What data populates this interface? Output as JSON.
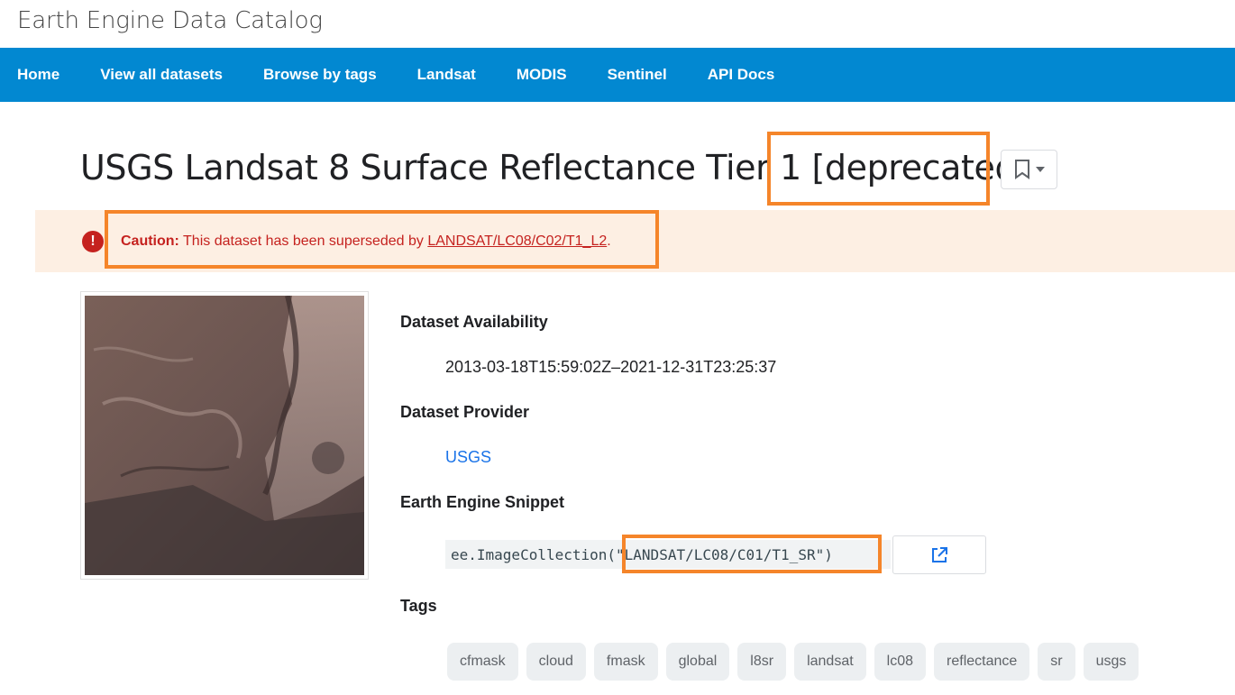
{
  "site": {
    "title": "Earth Engine Data Catalog"
  },
  "nav": {
    "items": [
      {
        "label": "Home"
      },
      {
        "label": "View all datasets"
      },
      {
        "label": "Browse by tags"
      },
      {
        "label": "Landsat"
      },
      {
        "label": "MODIS"
      },
      {
        "label": "Sentinel"
      },
      {
        "label": "API Docs"
      }
    ]
  },
  "dataset": {
    "title_main": "USGS Landsat 8 Surface Reflectance Tier 1 ",
    "title_status": "[deprecated]",
    "caution": {
      "label": "Caution:",
      "text": " This dataset has been superseded by ",
      "link": "LANDSAT/LC08/C02/T1_L2",
      "suffix": "."
    },
    "availability_label": "Dataset Availability",
    "availability_value": "2013-03-18T15:59:02Z–2021-12-31T23:25:37",
    "provider_label": "Dataset Provider",
    "provider_value": "USGS",
    "snippet_label": "Earth Engine Snippet",
    "snippet_prefix": "ee.ImageCollection",
    "snippet_arg": "(\"LANDSAT/LC08/C01/T1_SR\")",
    "tags_label": "Tags",
    "tags": [
      "cfmask",
      "cloud",
      "fmask",
      "global",
      "l8sr",
      "landsat",
      "lc08",
      "reflectance",
      "sr",
      "usgs"
    ]
  },
  "colors": {
    "nav_bg": "#0288d1",
    "caution_bg": "#fdefe3",
    "caution_text": "#c5221f",
    "highlight": "#f5852a",
    "link": "#1a73e8"
  },
  "icons": {
    "bookmark": "bookmark-icon",
    "dropdown": "caret-down-icon",
    "caution": "exclamation-icon",
    "open": "open-in-new-icon"
  }
}
